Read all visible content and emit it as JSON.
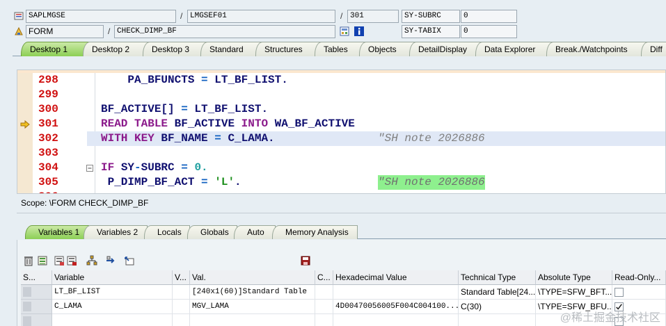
{
  "header": {
    "program": "SAPLMGSE",
    "include": "LMGSEF01",
    "line_no": "301",
    "sysvar1_name": "SY-SUBRC",
    "sysvar1_value": "0",
    "event_type": "FORM",
    "event_name": "CHECK_DIMP_BF",
    "sysvar2_name": "SY-TABIX",
    "sysvar2_value": "0",
    "separator": "/"
  },
  "top_tabs": [
    "Desktop 1",
    "Desktop 2",
    "Desktop 3",
    "Standard",
    "Structures",
    "Tables",
    "Objects",
    "DetailDisplay",
    "Data Explorer",
    "Break./Watchpoints",
    "Diff"
  ],
  "top_tabs_active": "Desktop 1",
  "editor": {
    "lines": [
      {
        "n": "298",
        "parts": [
          [
            "var",
            "    PA_BFUNCTS "
          ],
          [
            "op",
            "="
          ],
          [
            "var",
            " LT_BF_LIST."
          ]
        ]
      },
      {
        "n": "299",
        "parts": []
      },
      {
        "n": "300",
        "parts": [
          [
            "var",
            "BF_ACTIVE[] "
          ],
          [
            "op",
            "="
          ],
          [
            "var",
            " LT_BF_LIST."
          ]
        ]
      },
      {
        "n": "301",
        "parts": [
          [
            "kw",
            "READ TABLE "
          ],
          [
            "var",
            "BF_ACTIVE "
          ],
          [
            "kw",
            "INTO "
          ],
          [
            "var",
            "WA_BF_ACTIVE"
          ]
        ]
      },
      {
        "n": "302",
        "parts": [
          [
            "kw",
            "WITH KEY "
          ],
          [
            "var",
            "BF_NAME "
          ],
          [
            "op",
            "="
          ],
          [
            "var",
            " C_LAMA."
          ]
        ],
        "comment": "\"SH note 2026886"
      },
      {
        "n": "303",
        "parts": []
      },
      {
        "n": "304",
        "parts": [
          [
            "kw",
            "IF "
          ],
          [
            "var",
            "SY"
          ],
          [
            "op",
            "-"
          ],
          [
            "var",
            "SUBRC "
          ],
          [
            "op",
            "="
          ],
          [
            "num",
            " 0."
          ]
        ]
      },
      {
        "n": "305",
        "parts": [
          [
            "var",
            " P_DIMP_BF_ACT "
          ],
          [
            "op",
            "="
          ],
          [
            "str",
            " 'L'"
          ],
          [
            "var",
            "."
          ]
        ],
        "comment": "\"SH note 2026886",
        "comment_green": true
      },
      {
        "n": "306",
        "parts": [
          [
            "kw",
            " ..."
          ]
        ]
      }
    ],
    "current_line": "301",
    "highlight_line": "302"
  },
  "scope_text": "Scope: \\FORM CHECK_DIMP_BF",
  "bottom_tabs": [
    "Variables 1",
    "Variables 2",
    "Locals",
    "Globals",
    "Auto",
    "Memory Analysis"
  ],
  "bottom_tabs_active": "Variables 1",
  "grid": {
    "columns": [
      "S...",
      "Variable",
      "V...",
      "Val.",
      "C...",
      "Hexadecimal Value",
      "Technical Type",
      "Absolute Type",
      "Read-Only..."
    ],
    "rows": [
      [
        "",
        "LT_BF_LIST",
        "",
        "[240x1(60)]Standard Table",
        "",
        "",
        "Standard Table[24...",
        "\\TYPE=SFW_BFT...",
        "unchecked"
      ],
      [
        "",
        "C_LAMA",
        "",
        "MGV_LAMA",
        "",
        "4D00470056005F004C004100...",
        "C(30)",
        "\\TYPE=SFW_BFU...",
        "checked"
      ],
      [
        "",
        "",
        "",
        "",
        "",
        "",
        "",
        "",
        "unchecked"
      ]
    ]
  },
  "watermark": "@稀土掘金技术社区",
  "colors": {
    "active_tab": "#8ccf55",
    "line_number": "#d01010",
    "keyword": "#8b1a8b",
    "identifier": "#101070",
    "comment_highlight": "#8ef08e",
    "current_line_bg": "#e0e8f6"
  }
}
